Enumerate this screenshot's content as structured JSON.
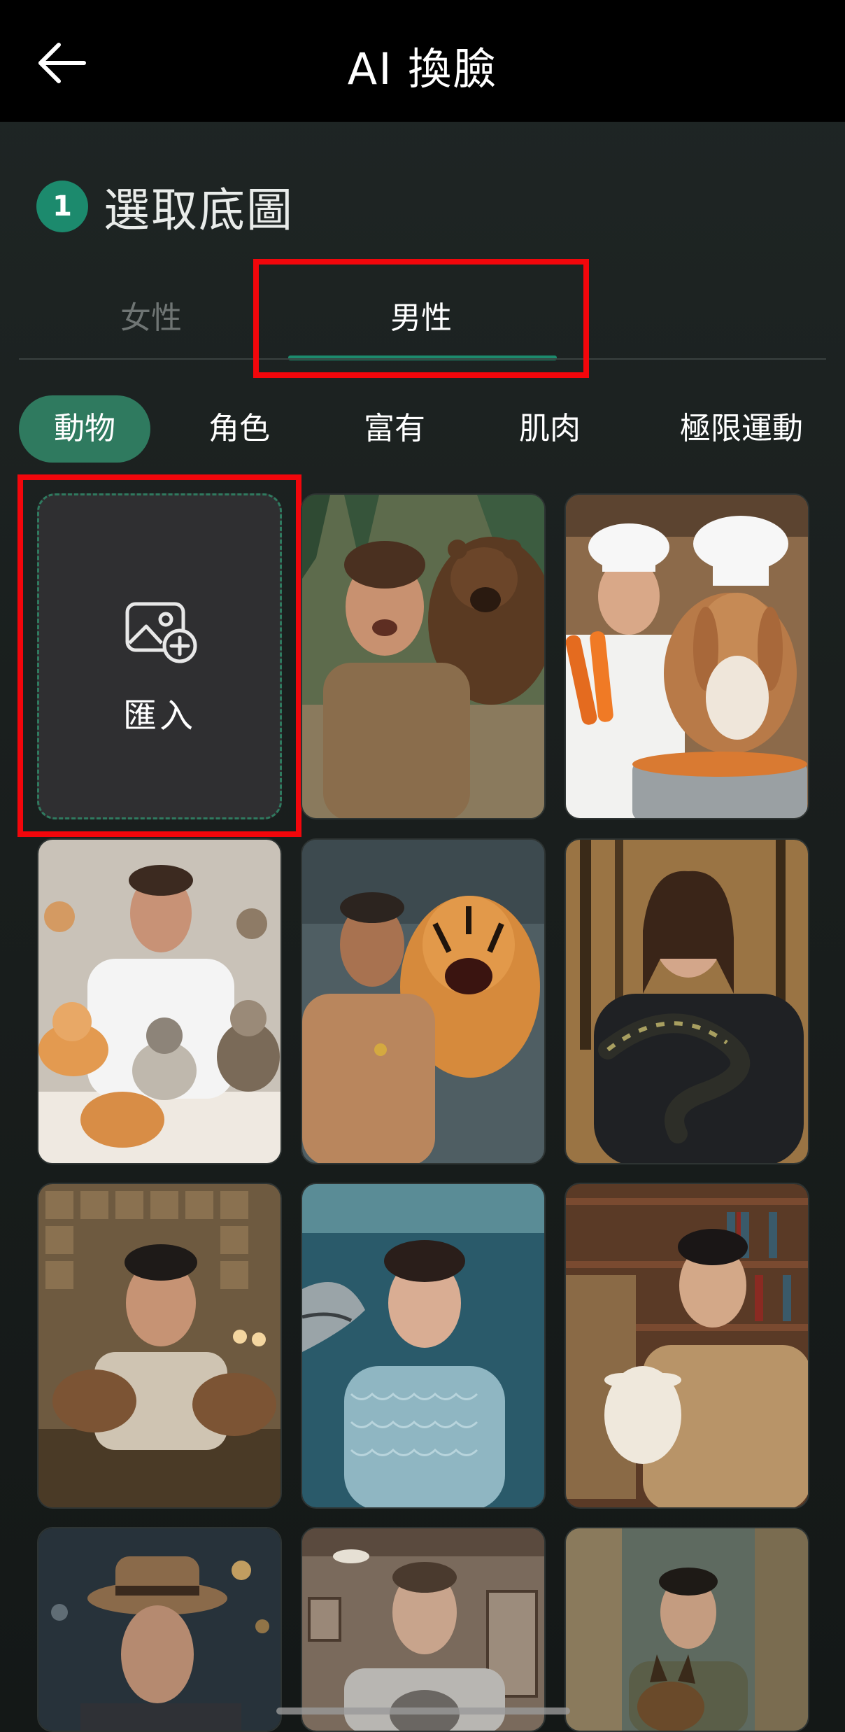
{
  "header": {
    "title": "AI 換臉",
    "back_icon": "arrow-left-icon"
  },
  "step": {
    "number": "1",
    "label": "選取底圖"
  },
  "gender_tabs": [
    {
      "label": "女性",
      "selected": false
    },
    {
      "label": "男性",
      "selected": true
    }
  ],
  "categories": [
    {
      "label": "動物",
      "selected": true
    },
    {
      "label": "角色",
      "selected": false
    },
    {
      "label": "富有",
      "selected": false
    },
    {
      "label": "肌肉",
      "selected": false
    },
    {
      "label": "極限運動",
      "selected": false
    }
  ],
  "import_tile": {
    "label": "匯入",
    "icon": "add-image-icon"
  },
  "templates": [
    {
      "name": "man-with-bear"
    },
    {
      "name": "chef-with-rabbit"
    },
    {
      "name": "man-with-cats"
    },
    {
      "name": "man-with-tiger"
    },
    {
      "name": "man-with-snake"
    },
    {
      "name": "man-with-capybaras"
    },
    {
      "name": "man-with-shark"
    },
    {
      "name": "man-with-goat"
    },
    {
      "name": "man-in-fedora"
    },
    {
      "name": "man-with-husky"
    },
    {
      "name": "man-with-shepherd-dog"
    }
  ],
  "colors": {
    "accent": "#1c8a6d",
    "chip_active": "#2f7a5f",
    "highlight": "#f2060b",
    "header_bg": "#000000"
  }
}
